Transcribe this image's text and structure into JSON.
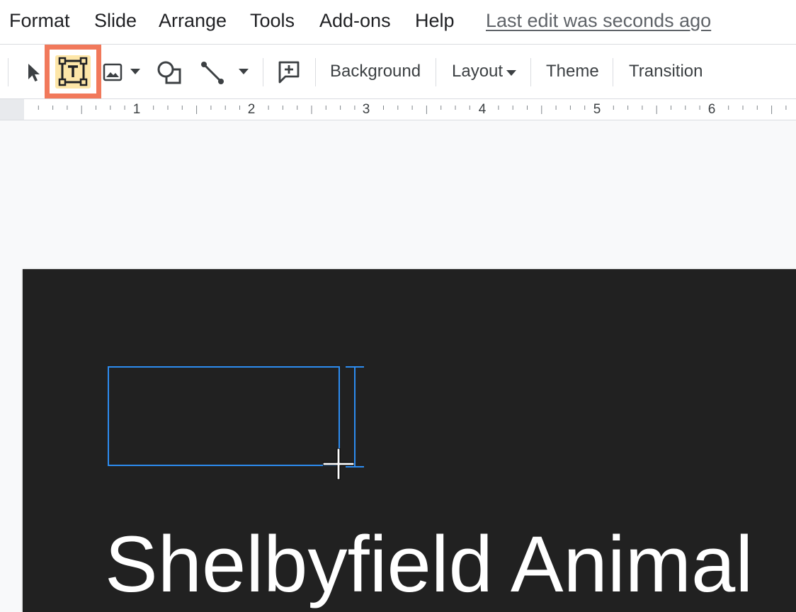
{
  "menu": {
    "items": [
      {
        "label": "Format"
      },
      {
        "label": "Slide"
      },
      {
        "label": "Arrange"
      },
      {
        "label": "Tools"
      },
      {
        "label": "Add-ons"
      },
      {
        "label": "Help"
      }
    ],
    "last_edit": "Last edit was seconds ago"
  },
  "toolbar": {
    "select_icon": "cursor-arrow-icon",
    "textbox_icon": "text-box-icon",
    "image_icon": "image-icon",
    "shape_icon": "shape-icon",
    "line_icon": "line-icon",
    "comment_icon": "add-comment-icon",
    "background_label": "Background",
    "layout_label": "Layout",
    "theme_label": "Theme",
    "transition_label": "Transition",
    "highlight_color": "#f1795b",
    "active_tool_bg": "#fde6a8"
  },
  "ruler": {
    "numbers": [
      "1",
      "2",
      "3",
      "4",
      "5",
      "6"
    ]
  },
  "slide": {
    "title": "Shelbyfield Animal",
    "background": "#212121",
    "selection_color": "#2d8cf0"
  }
}
